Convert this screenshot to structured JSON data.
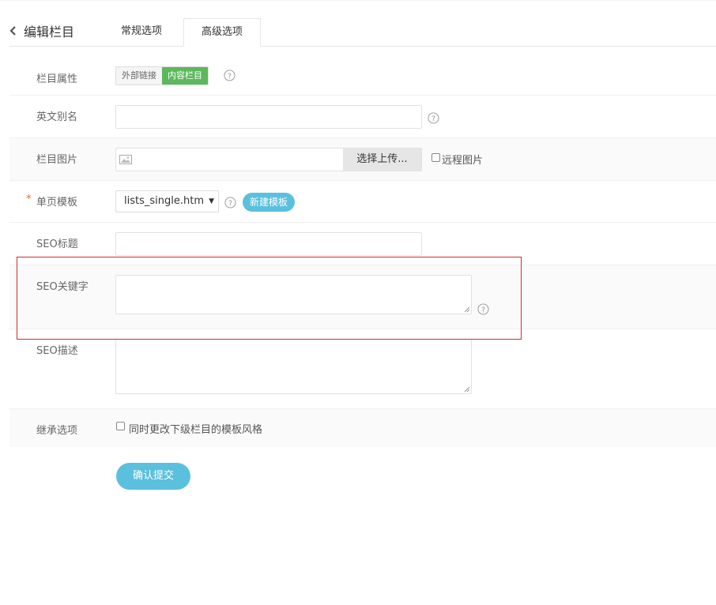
{
  "header": {
    "back_title": "编辑栏目",
    "tabs": [
      {
        "label": "常规选项"
      },
      {
        "label": "高级选项"
      }
    ]
  },
  "form": {
    "attribute": {
      "label": "栏目属性",
      "options": [
        "外部链接",
        "内容栏目"
      ],
      "selected": "内容栏目"
    },
    "alias": {
      "label": "英文别名",
      "value": ""
    },
    "image": {
      "label": "栏目图片",
      "upload_label": "选择上传...",
      "remote_label": "远程图片",
      "remote_checked": false
    },
    "template": {
      "label": "单页模板",
      "required_mark": "*",
      "value": "lists_single.htm",
      "new_label": "新建模板"
    },
    "seo_title": {
      "label": "SEO标题",
      "value": ""
    },
    "seo_keywords": {
      "label": "SEO关键字",
      "value": ""
    },
    "seo_description": {
      "label": "SEO描述",
      "value": ""
    },
    "inherit": {
      "label": "继承选项",
      "checkbox_label": "同时更改下级栏目的模板风格",
      "checked": false
    }
  },
  "actions": {
    "submit_label": "确认提交"
  },
  "colors": {
    "accent": "#5bc0de",
    "active_segment": "#5cb85c",
    "required": "#f26522",
    "highlight": "#c9302c"
  },
  "icons": [
    "chevron-left-icon",
    "help-icon",
    "image-icon",
    "caret-down-icon"
  ]
}
